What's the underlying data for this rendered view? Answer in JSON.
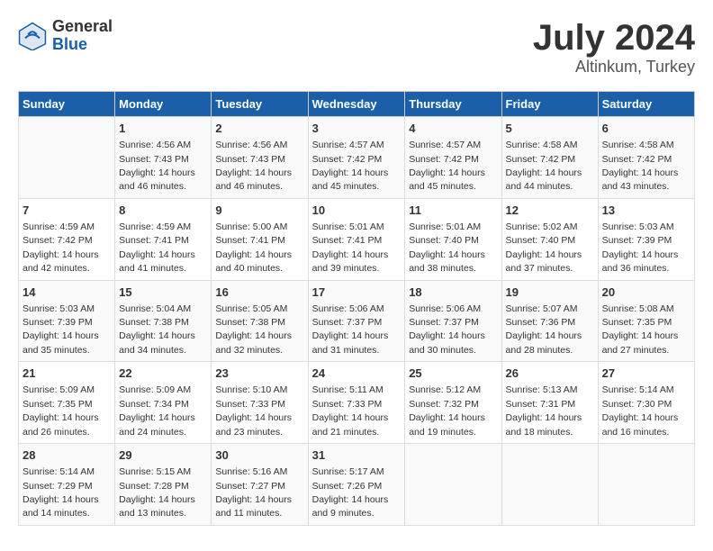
{
  "logo": {
    "general": "General",
    "blue": "Blue"
  },
  "title": "July 2024",
  "subtitle": "Altinkum, Turkey",
  "columns": [
    "Sunday",
    "Monday",
    "Tuesday",
    "Wednesday",
    "Thursday",
    "Friday",
    "Saturday"
  ],
  "weeks": [
    [
      {
        "day": "",
        "info": ""
      },
      {
        "day": "1",
        "info": "Sunrise: 4:56 AM\nSunset: 7:43 PM\nDaylight: 14 hours\nand 46 minutes."
      },
      {
        "day": "2",
        "info": "Sunrise: 4:56 AM\nSunset: 7:43 PM\nDaylight: 14 hours\nand 46 minutes."
      },
      {
        "day": "3",
        "info": "Sunrise: 4:57 AM\nSunset: 7:42 PM\nDaylight: 14 hours\nand 45 minutes."
      },
      {
        "day": "4",
        "info": "Sunrise: 4:57 AM\nSunset: 7:42 PM\nDaylight: 14 hours\nand 45 minutes."
      },
      {
        "day": "5",
        "info": "Sunrise: 4:58 AM\nSunset: 7:42 PM\nDaylight: 14 hours\nand 44 minutes."
      },
      {
        "day": "6",
        "info": "Sunrise: 4:58 AM\nSunset: 7:42 PM\nDaylight: 14 hours\nand 43 minutes."
      }
    ],
    [
      {
        "day": "7",
        "info": "Sunrise: 4:59 AM\nSunset: 7:42 PM\nDaylight: 14 hours\nand 42 minutes."
      },
      {
        "day": "8",
        "info": "Sunrise: 4:59 AM\nSunset: 7:41 PM\nDaylight: 14 hours\nand 41 minutes."
      },
      {
        "day": "9",
        "info": "Sunrise: 5:00 AM\nSunset: 7:41 PM\nDaylight: 14 hours\nand 40 minutes."
      },
      {
        "day": "10",
        "info": "Sunrise: 5:01 AM\nSunset: 7:41 PM\nDaylight: 14 hours\nand 39 minutes."
      },
      {
        "day": "11",
        "info": "Sunrise: 5:01 AM\nSunset: 7:40 PM\nDaylight: 14 hours\nand 38 minutes."
      },
      {
        "day": "12",
        "info": "Sunrise: 5:02 AM\nSunset: 7:40 PM\nDaylight: 14 hours\nand 37 minutes."
      },
      {
        "day": "13",
        "info": "Sunrise: 5:03 AM\nSunset: 7:39 PM\nDaylight: 14 hours\nand 36 minutes."
      }
    ],
    [
      {
        "day": "14",
        "info": "Sunrise: 5:03 AM\nSunset: 7:39 PM\nDaylight: 14 hours\nand 35 minutes."
      },
      {
        "day": "15",
        "info": "Sunrise: 5:04 AM\nSunset: 7:38 PM\nDaylight: 14 hours\nand 34 minutes."
      },
      {
        "day": "16",
        "info": "Sunrise: 5:05 AM\nSunset: 7:38 PM\nDaylight: 14 hours\nand 32 minutes."
      },
      {
        "day": "17",
        "info": "Sunrise: 5:06 AM\nSunset: 7:37 PM\nDaylight: 14 hours\nand 31 minutes."
      },
      {
        "day": "18",
        "info": "Sunrise: 5:06 AM\nSunset: 7:37 PM\nDaylight: 14 hours\nand 30 minutes."
      },
      {
        "day": "19",
        "info": "Sunrise: 5:07 AM\nSunset: 7:36 PM\nDaylight: 14 hours\nand 28 minutes."
      },
      {
        "day": "20",
        "info": "Sunrise: 5:08 AM\nSunset: 7:35 PM\nDaylight: 14 hours\nand 27 minutes."
      }
    ],
    [
      {
        "day": "21",
        "info": "Sunrise: 5:09 AM\nSunset: 7:35 PM\nDaylight: 14 hours\nand 26 minutes."
      },
      {
        "day": "22",
        "info": "Sunrise: 5:09 AM\nSunset: 7:34 PM\nDaylight: 14 hours\nand 24 minutes."
      },
      {
        "day": "23",
        "info": "Sunrise: 5:10 AM\nSunset: 7:33 PM\nDaylight: 14 hours\nand 23 minutes."
      },
      {
        "day": "24",
        "info": "Sunrise: 5:11 AM\nSunset: 7:33 PM\nDaylight: 14 hours\nand 21 minutes."
      },
      {
        "day": "25",
        "info": "Sunrise: 5:12 AM\nSunset: 7:32 PM\nDaylight: 14 hours\nand 19 minutes."
      },
      {
        "day": "26",
        "info": "Sunrise: 5:13 AM\nSunset: 7:31 PM\nDaylight: 14 hours\nand 18 minutes."
      },
      {
        "day": "27",
        "info": "Sunrise: 5:14 AM\nSunset: 7:30 PM\nDaylight: 14 hours\nand 16 minutes."
      }
    ],
    [
      {
        "day": "28",
        "info": "Sunrise: 5:14 AM\nSunset: 7:29 PM\nDaylight: 14 hours\nand 14 minutes."
      },
      {
        "day": "29",
        "info": "Sunrise: 5:15 AM\nSunset: 7:28 PM\nDaylight: 14 hours\nand 13 minutes."
      },
      {
        "day": "30",
        "info": "Sunrise: 5:16 AM\nSunset: 7:27 PM\nDaylight: 14 hours\nand 11 minutes."
      },
      {
        "day": "31",
        "info": "Sunrise: 5:17 AM\nSunset: 7:26 PM\nDaylight: 14 hours\nand 9 minutes."
      },
      {
        "day": "",
        "info": ""
      },
      {
        "day": "",
        "info": ""
      },
      {
        "day": "",
        "info": ""
      }
    ]
  ]
}
